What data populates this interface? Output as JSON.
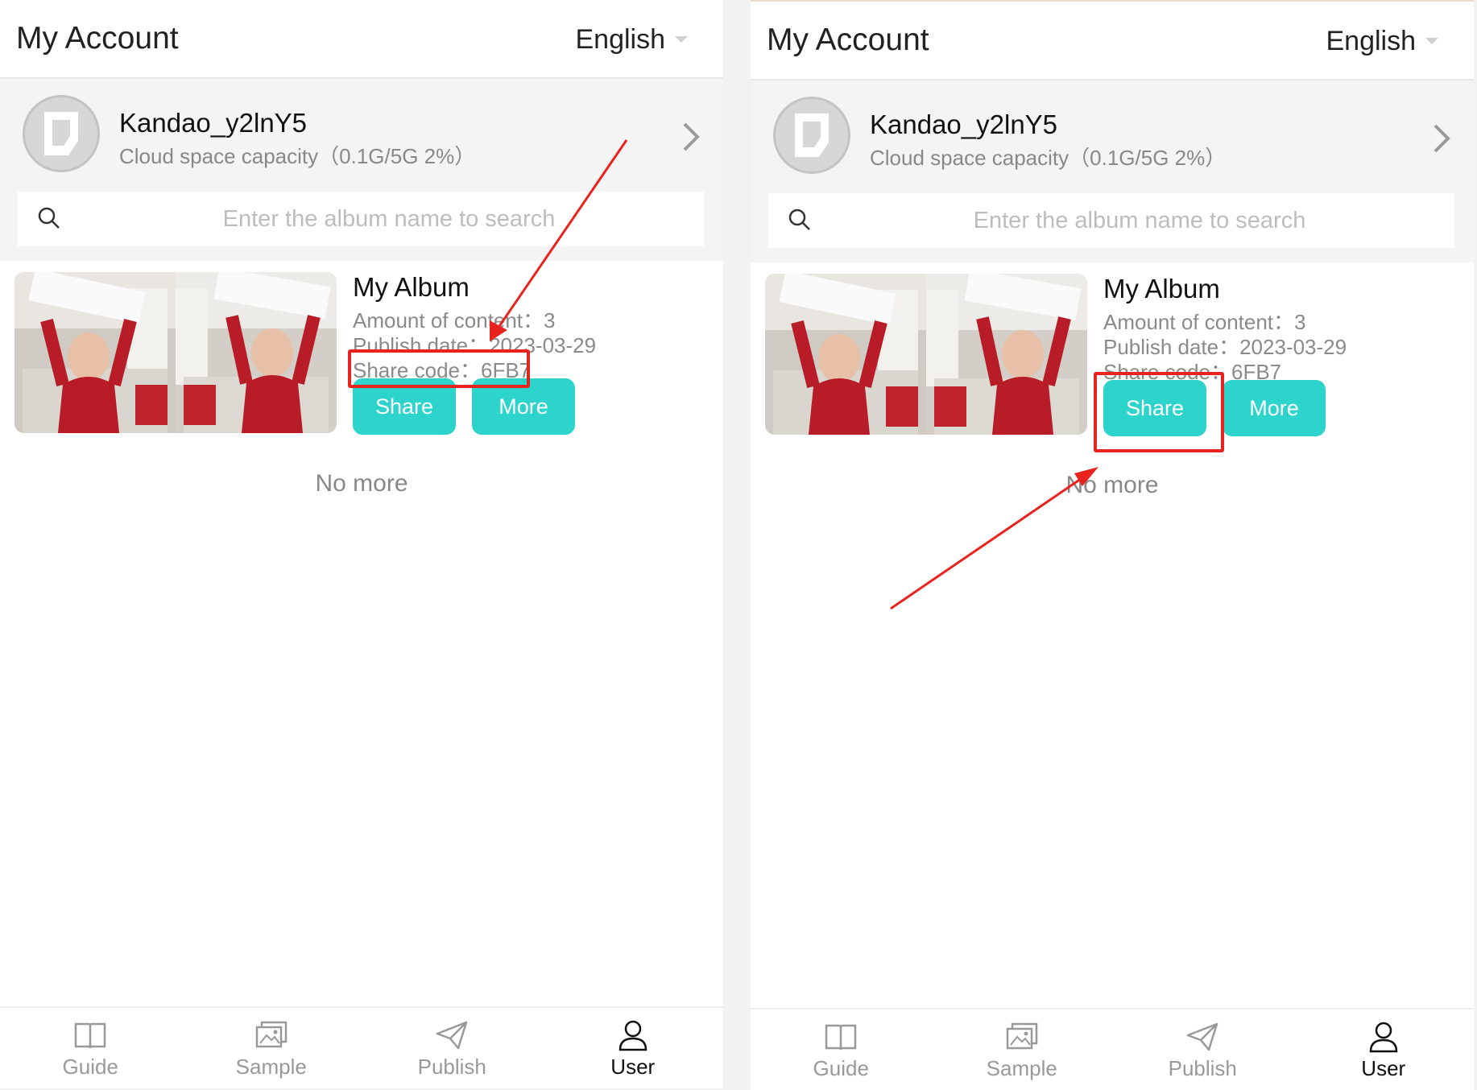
{
  "colors": {
    "accent": "#2dd4cc",
    "annotation": "#e8231e"
  },
  "panels": [
    {
      "header": {
        "title": "My Account",
        "language": "English"
      },
      "profile": {
        "username": "Kandao_y2lnY5",
        "capacity": "Cloud space capacity（0.1G/5G 2%）"
      },
      "search": {
        "placeholder": "Enter the album name to search"
      },
      "album": {
        "name": "My Album",
        "amount": "Amount of content：3",
        "publish": "Publish date：2023-03-29",
        "share_code": "Share code：6FB7",
        "share_label": "Share",
        "more_label": "More"
      },
      "list_end": "No more",
      "tabs": [
        {
          "label": "Guide",
          "icon": "book-icon"
        },
        {
          "label": "Sample",
          "icon": "gallery-icon"
        },
        {
          "label": "Publish",
          "icon": "send-icon"
        },
        {
          "label": "User",
          "icon": "user-icon",
          "active": true
        }
      ]
    },
    {
      "header": {
        "title": "My Account",
        "language": "English"
      },
      "profile": {
        "username": "Kandao_y2lnY5",
        "capacity": "Cloud space capacity（0.1G/5G 2%）"
      },
      "search": {
        "placeholder": "Enter the album name to search"
      },
      "album": {
        "name": "My Album",
        "amount": "Amount of content：3",
        "publish": "Publish date：2023-03-29",
        "share_code": "Share code：6FB7",
        "share_label": "Share",
        "more_label": "More"
      },
      "list_end": "No more",
      "tabs": [
        {
          "label": "Guide",
          "icon": "book-icon"
        },
        {
          "label": "Sample",
          "icon": "gallery-icon"
        },
        {
          "label": "Publish",
          "icon": "send-icon"
        },
        {
          "label": "User",
          "icon": "user-icon",
          "active": true
        }
      ]
    }
  ]
}
